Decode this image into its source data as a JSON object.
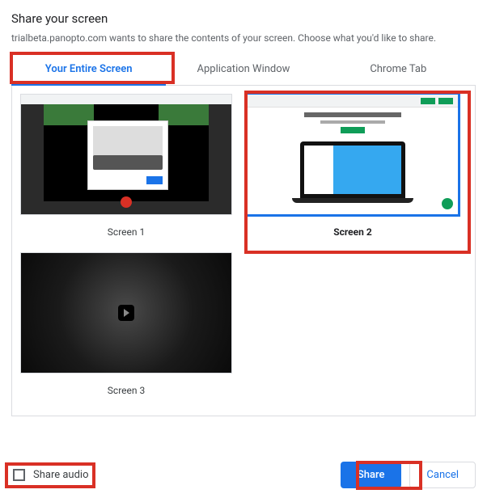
{
  "header": {
    "title": "Share your screen",
    "subtitle": "trialbeta.panopto.com wants to share the contents of your screen. Choose what you'd like to share."
  },
  "tabs": {
    "entire": "Your Entire Screen",
    "window": "Application Window",
    "chrome": "Chrome Tab"
  },
  "screens": {
    "s1": "Screen 1",
    "s2": "Screen 2",
    "s3": "Screen 3"
  },
  "footer": {
    "share_audio": "Share audio",
    "share": "Share",
    "cancel": "Cancel"
  }
}
